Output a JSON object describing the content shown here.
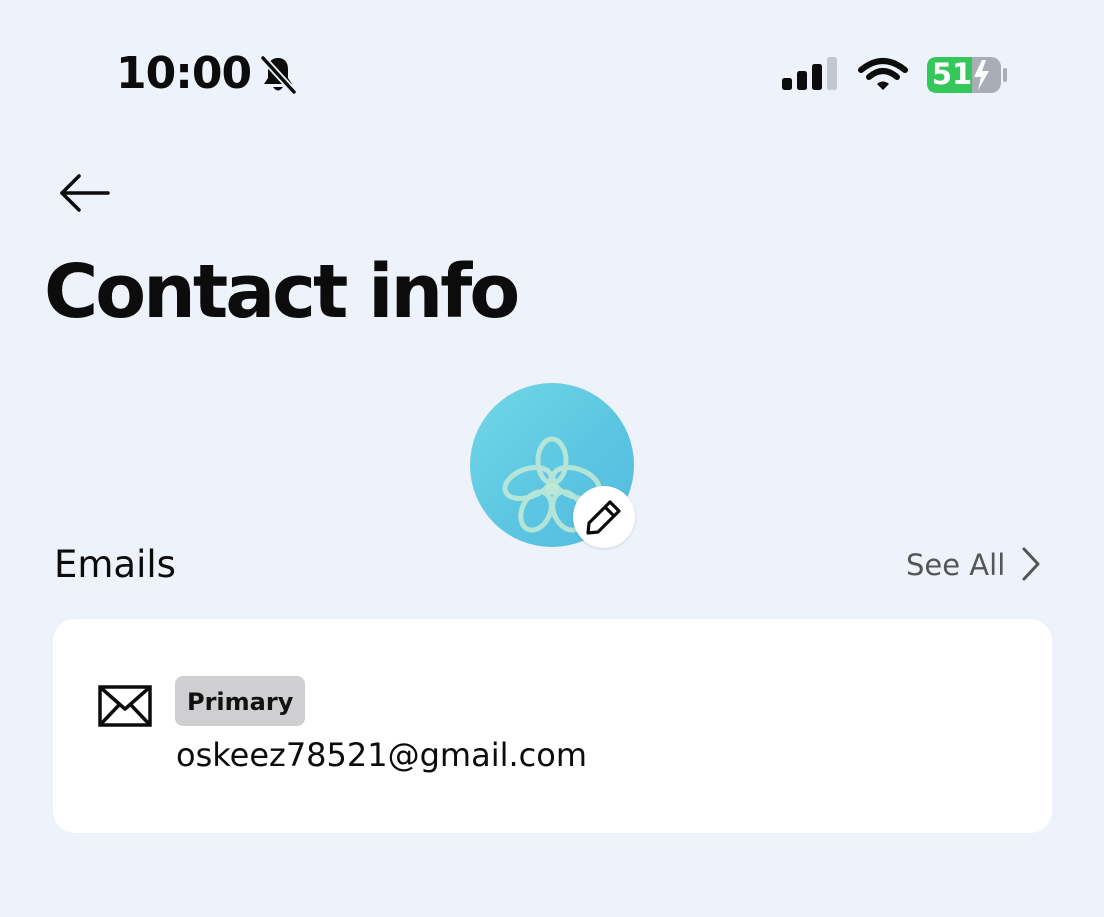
{
  "status_bar": {
    "time": "10:00",
    "battery_level": "51",
    "icons": [
      "bell-slash-icon",
      "cellular-signal-icon",
      "wifi-icon",
      "battery-charging-icon"
    ],
    "battery_color": "#34c759"
  },
  "nav": {
    "back_icon": "arrow-left-icon"
  },
  "page": {
    "title": "Contact info"
  },
  "avatar": {
    "colors": [
      "#72d7e6",
      "#54b9e0"
    ],
    "edit_icon": "pencil-icon"
  },
  "emails_section": {
    "title": "Emails",
    "see_all_label": "See All",
    "items": [
      {
        "badge": "Primary",
        "address": "oskeez78521@gmail.com",
        "icon": "envelope-icon"
      }
    ]
  }
}
